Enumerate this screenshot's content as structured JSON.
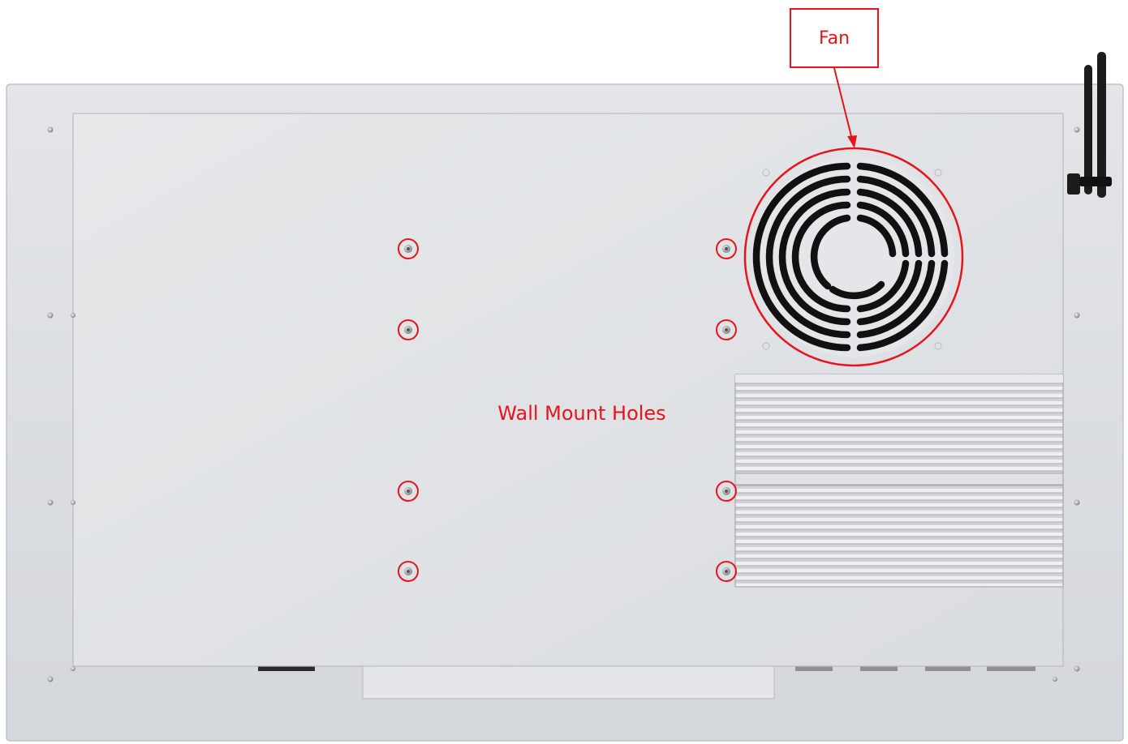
{
  "labels": {
    "fan": "Fan",
    "wall_mount_holes": "Wall Mount Holes"
  },
  "colors": {
    "annotation": "#e8141b",
    "panel_outer": "#dcdfe2",
    "panel_inner": "#e2e4e7",
    "heatsink": "#d3d6da",
    "fan_slot": "#111111"
  },
  "icons": {
    "fan": "fan-grille-icon",
    "antenna": "antenna-icon",
    "screw": "screw-icon"
  }
}
